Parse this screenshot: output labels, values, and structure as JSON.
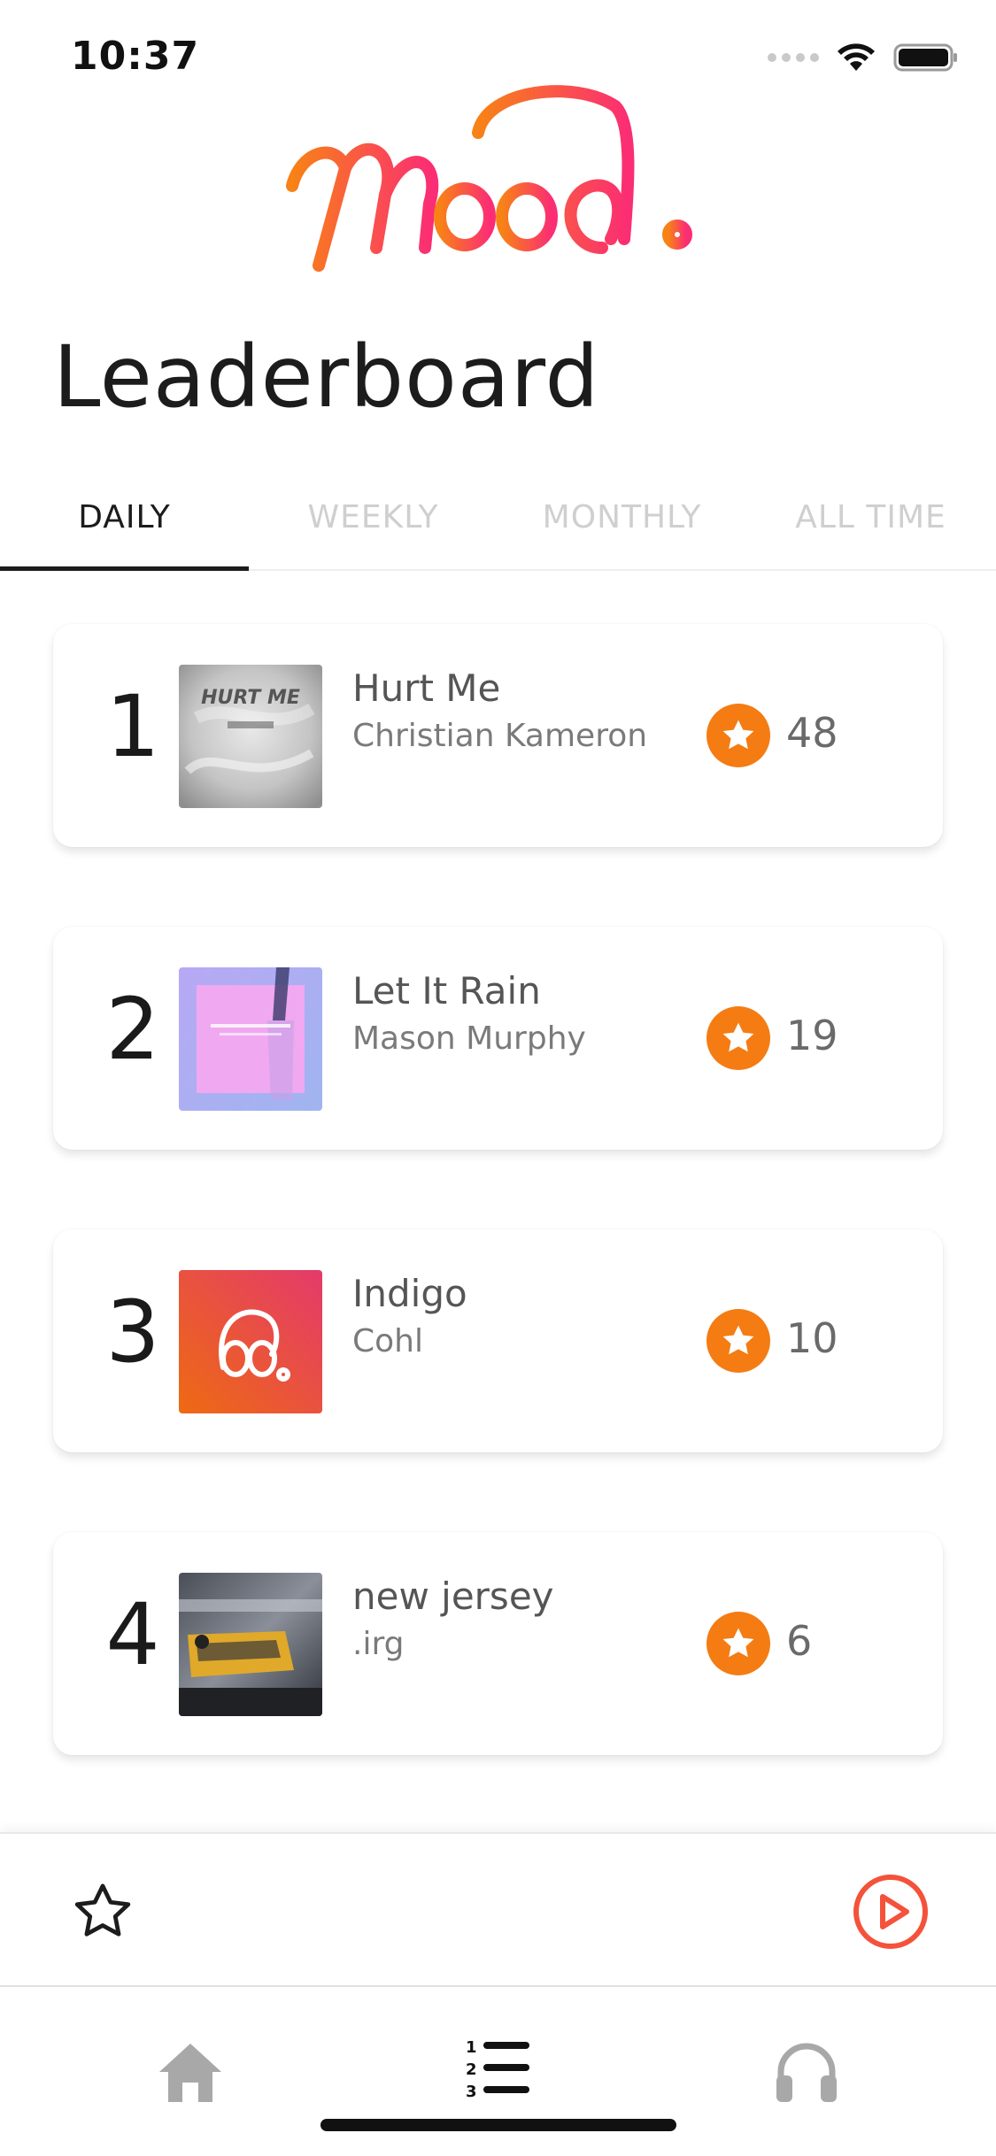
{
  "status_bar": {
    "time": "10:37"
  },
  "header": {
    "logo_text": "Mood.",
    "title": "Leaderboard"
  },
  "tabs": [
    {
      "label": "DAILY",
      "active": true
    },
    {
      "label": "WEEKLY",
      "active": false
    },
    {
      "label": "MONTHLY",
      "active": false
    },
    {
      "label": "ALL TIME",
      "active": false
    }
  ],
  "leaderboard": [
    {
      "rank": "1",
      "title": "Hurt Me",
      "artist": "Christian Kameron",
      "score": "48",
      "cover_text": "HURT ME"
    },
    {
      "rank": "2",
      "title": "Let It Rain",
      "artist": "Mason Murphy",
      "score": "19"
    },
    {
      "rank": "3",
      "title": "Indigo",
      "artist": "Cohl",
      "score": "10"
    },
    {
      "rank": "4",
      "title": "new jersey",
      "artist": ".irg",
      "score": "6"
    }
  ],
  "player": {
    "favorite_icon": "star-outline-icon",
    "play_icon": "play-circle-icon"
  },
  "nav": [
    {
      "icon": "home-icon",
      "active": false
    },
    {
      "icon": "leaderboard-list-icon",
      "active": true
    },
    {
      "icon": "headphones-icon",
      "active": false
    }
  ],
  "colors": {
    "accent_orange": "#f47c13",
    "accent_pink": "#ff3d6e",
    "play_red": "#f4523a",
    "text_dark": "#1c1c1c",
    "tab_inactive": "#cfcfcf"
  }
}
